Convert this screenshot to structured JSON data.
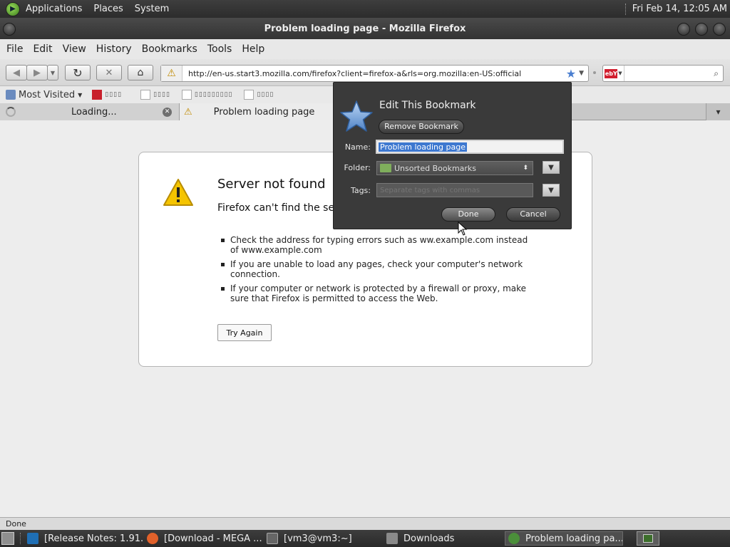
{
  "top_panel": {
    "menus": [
      "Applications",
      "Places",
      "System"
    ],
    "clock": "Fri Feb 14, 12:05 AM"
  },
  "window": {
    "title": "Problem loading page - Mozilla Firefox"
  },
  "menubar": [
    "File",
    "Edit",
    "View",
    "History",
    "Bookmarks",
    "Tools",
    "Help"
  ],
  "nav": {
    "url": "http://en-us.start3.mozilla.com/firefox?client=firefox-a&rls=org.mozilla:en-US:official",
    "icons": [
      "back-icon",
      "forward-icon",
      "reload-icon",
      "stop-icon",
      "home-icon",
      "bookmark-star-icon"
    ]
  },
  "bookmarks_bar": {
    "most_visited": "Most Visited"
  },
  "tabs": [
    {
      "title": "Loading..."
    },
    {
      "title": "Problem loading page"
    }
  ],
  "error_page": {
    "title": "Server not found",
    "subtitle": "Firefox can't find the serv",
    "bullets": [
      "Check the address for typing errors such as ww.example.com instead of www.example.com",
      "If you are unable to load any pages, check your computer's network connection.",
      "If your computer or network is protected by a firewall or proxy, make sure that Firefox is permitted to access the Web."
    ],
    "try_again": "Try Again"
  },
  "bookmark_panel": {
    "title": "Edit This Bookmark",
    "remove_label": "Remove Bookmark",
    "name_label": "Name:",
    "name_value": "Problem loading page",
    "folder_label": "Folder:",
    "folder_value": "Unsorted Bookmarks",
    "tags_label": "Tags:",
    "tags_placeholder": "Separate tags with commas",
    "done_label": "Done",
    "cancel_label": "Cancel"
  },
  "status": "Done",
  "taskbar": [
    {
      "label": "[Release Notes: 1.91...",
      "active": false
    },
    {
      "label": "[Download - MEGA ...",
      "active": false
    },
    {
      "label": "[vm3@vm3:~]",
      "active": false
    },
    {
      "label": "Downloads",
      "active": false
    },
    {
      "label": "Problem loading pa...",
      "active": true
    }
  ],
  "colors": {
    "panel_bg": "#2c2c2c",
    "selection_blue": "#3d78d0",
    "warning_yellow": "#f5c400",
    "star_blue": "#4b7fd0"
  }
}
